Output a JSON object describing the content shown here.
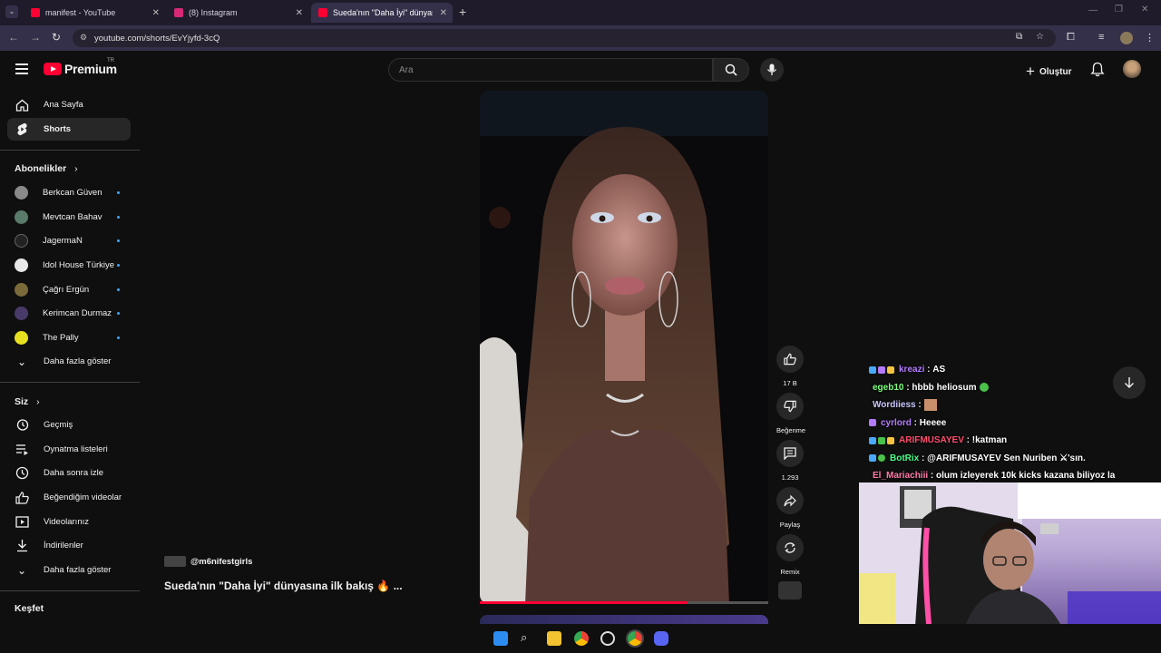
{
  "browser": {
    "tabs": [
      {
        "title": "manifest - YouTube",
        "favicon_color": "#ff0033"
      },
      {
        "title": "(8) Instagram",
        "favicon_color": "#d62976"
      },
      {
        "title": "Sueda'nın \"Daha İyi\" dünyasına",
        "favicon_color": "#ff0033"
      }
    ],
    "url": "youtube.com/shorts/EvYjyfd-3cQ"
  },
  "masthead": {
    "logo_text": "Premium",
    "country_code": "TR",
    "search_placeholder": "Ara",
    "create_label": "Oluştur"
  },
  "sidebar": {
    "main": [
      {
        "label": "Ana Sayfa",
        "icon": "home-icon"
      },
      {
        "label": "Shorts",
        "icon": "shorts-icon"
      }
    ],
    "subscriptions_header": "Abonelikler",
    "subscriptions": [
      {
        "label": "Berkcan Güven",
        "color": "#8a8a8a"
      },
      {
        "label": "Mevtcan Bahav",
        "color": "#5a7a6a"
      },
      {
        "label": "JagermaN",
        "color": "#222222"
      },
      {
        "label": "Idol House Türkiye",
        "color": "#e8e8e8"
      },
      {
        "label": "Çağrı Ergün",
        "color": "#7a6a3a"
      },
      {
        "label": "Kerimcan Durmaz",
        "color": "#4a3a6a"
      },
      {
        "label": "The Pally",
        "color": "#e6e020"
      }
    ],
    "show_more": "Daha fazla göster",
    "you_header": "Siz",
    "you_items": [
      {
        "label": "Geçmiş",
        "icon": "history-icon"
      },
      {
        "label": "Oynatma listeleri",
        "icon": "playlists-icon"
      },
      {
        "label": "Daha sonra izle",
        "icon": "watch-later-icon"
      },
      {
        "label": "Beğendiğim videolar",
        "icon": "liked-videos-icon"
      },
      {
        "label": "Videolarınız",
        "icon": "your-videos-icon"
      },
      {
        "label": "İndirilenler",
        "icon": "downloads-icon"
      },
      {
        "label": "Daha fazla göster",
        "icon": "chevron-down-icon"
      }
    ],
    "explore_header": "Keşfet"
  },
  "short": {
    "channel": "@m6nifestgirls",
    "title": "Sueda'nın \"Daha İyi\" dünyasına ilk bakış 🔥 ...",
    "progress": 0.72,
    "actions": {
      "like_count": "17 B",
      "dislike_label": "Beğenme",
      "comment_count": "1.293",
      "share_label": "Paylaş",
      "remix_label": "Remix"
    }
  },
  "chat": [
    {
      "user": "kreazi",
      "msg": "AS",
      "color": "#b57bff"
    },
    {
      "user": "egeb10",
      "msg": "hbbb heliosum",
      "color": "#7cff7c"
    },
    {
      "user": "Wordiiess",
      "msg": "",
      "color": "#c8c8ff"
    },
    {
      "user": "cyrlord",
      "msg": "Heeee",
      "color": "#b57bff"
    },
    {
      "user": "ARIFMUSAYEV",
      "msg": "!katman",
      "color": "#ff4d6d"
    },
    {
      "user": "BotRix",
      "msg": "@ARIFMUSAYEV Sen Nuriben ⚔'sın.",
      "color": "#4dff88"
    },
    {
      "user": "El_Mariachiii",
      "msg": "olum izleyerek 10k kicks kazana biliyoz la",
      "color": "#ff7aa8"
    }
  ]
}
